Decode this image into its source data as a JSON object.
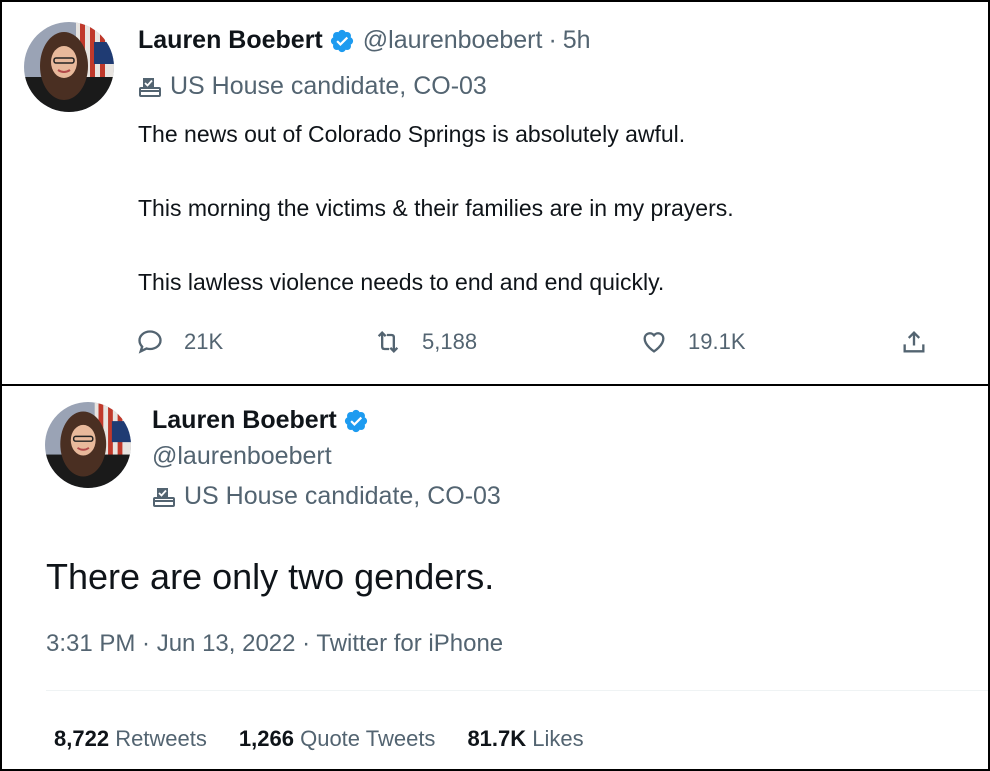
{
  "top_tweet": {
    "author": {
      "display_name": "Lauren Boebert",
      "handle": "@laurenboebert",
      "separator": "·",
      "time": "5h",
      "verified_icon": "verified-badge-icon"
    },
    "label": {
      "icon": "ballot-box-icon",
      "text": "US House candidate, CO-03"
    },
    "text_lines": [
      "The news out of Colorado Springs is absolutely awful.",
      "This morning the victims & their families are in my prayers.",
      "This lawless violence needs to end and end quickly."
    ],
    "actions": {
      "reply": {
        "icon": "reply-icon",
        "count": "21K"
      },
      "retweet": {
        "icon": "retweet-icon",
        "count": "5,188"
      },
      "like": {
        "icon": "heart-icon",
        "count": "19.1K"
      },
      "share": {
        "icon": "share-icon"
      }
    }
  },
  "bottom_tweet": {
    "author": {
      "display_name": "Lauren Boebert",
      "handle": "@laurenboebert",
      "verified_icon": "verified-badge-icon"
    },
    "label": {
      "icon": "ballot-box-icon",
      "text": "US House candidate, CO-03"
    },
    "text": "There are only two genders.",
    "meta": "3:31 PM · Jun 13, 2022 · Twitter for iPhone",
    "stats": {
      "retweets": {
        "count": "8,722",
        "label": "Retweets"
      },
      "quotes": {
        "count": "1,266",
        "label": "Quote Tweets"
      },
      "likes": {
        "count": "81.7K",
        "label": "Likes"
      }
    }
  },
  "colors": {
    "verified": "#1d9bf0",
    "secondary_text": "#536471",
    "primary_text": "#0f1419"
  }
}
